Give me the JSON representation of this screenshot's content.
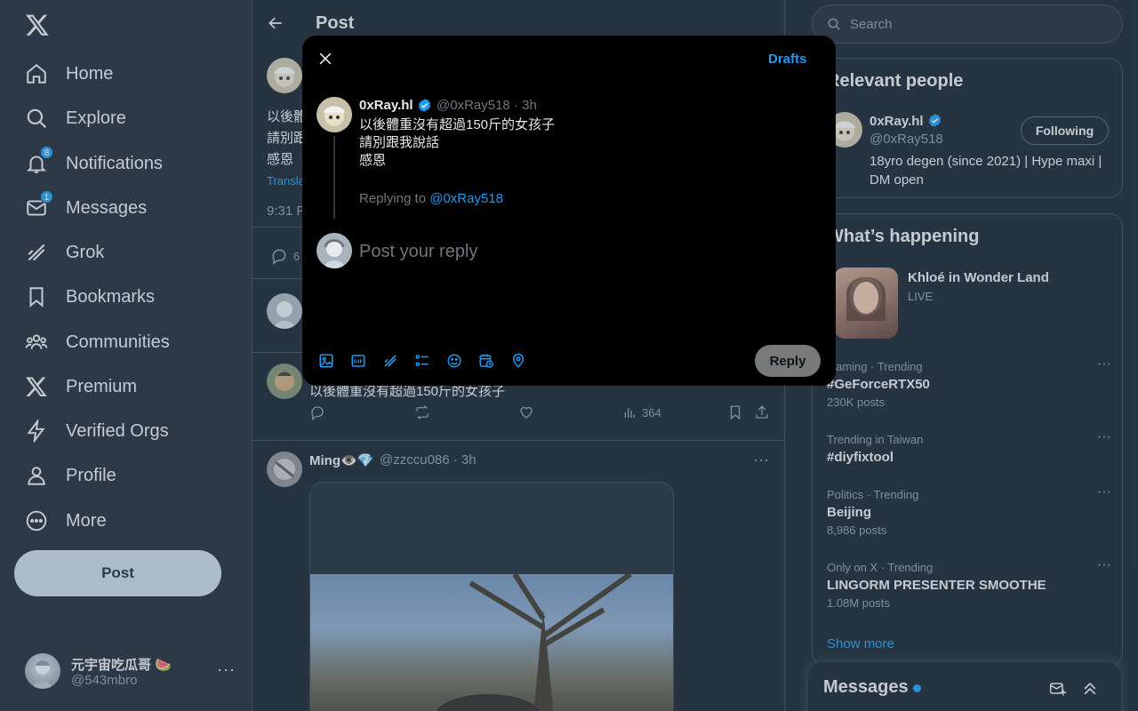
{
  "nav": {
    "items": [
      {
        "label": "Home"
      },
      {
        "label": "Explore"
      },
      {
        "label": "Notifications",
        "badge": "8"
      },
      {
        "label": "Messages",
        "badge": "1"
      },
      {
        "label": "Grok"
      },
      {
        "label": "Bookmarks"
      },
      {
        "label": "Communities"
      },
      {
        "label": "Premium"
      },
      {
        "label": "Verified Orgs"
      },
      {
        "label": "Profile"
      },
      {
        "label": "More"
      }
    ],
    "post_button": "Post",
    "account": {
      "name": "元宇宙吃瓜哥 🍉",
      "handle": "@543mbro",
      "menu": "···"
    }
  },
  "main": {
    "title": "Post",
    "bg_tweet": {
      "line1": "以後體",
      "line2": "請別跟",
      "line3": "感恩",
      "translate": "Transla",
      "time": "9:31 P",
      "reply_count": "6"
    },
    "reply_tweet": {
      "text": "以後體重沒有超過150斤的女孩子",
      "views": "364"
    },
    "tweet2": {
      "name": "Ming👁️💎",
      "meta": "@zzccu086 · 3h",
      "menu": "···"
    }
  },
  "sidebar": {
    "search_placeholder": "Search",
    "relevant": {
      "title": "Relevant people",
      "name": "0xRay.hl",
      "handle": "@0xRay518",
      "bio": "18yro degen (since 2021) | Hype maxi | DM open",
      "follow_label": "Following"
    },
    "happening": {
      "title": "What’s happening",
      "live": {
        "title": "Khloé in Wonder Land",
        "sub": "LIVE"
      },
      "trends": [
        {
          "context": "Gaming · Trending",
          "title": "#GeForceRTX50",
          "count": "230K posts"
        },
        {
          "context": "Trending in Taiwan",
          "title": "#diyfixtool",
          "count": ""
        },
        {
          "context": "Politics · Trending",
          "title": "Beijing",
          "count": "8,986 posts"
        },
        {
          "context": "Only on X · Trending",
          "title": "LINGORM PRESENTER SMOOTHE",
          "count": "1.08M posts"
        }
      ],
      "show_more": "Show more"
    },
    "messages_drawer": "Messages"
  },
  "modal": {
    "drafts": "Drafts",
    "author": {
      "name": "0xRay.hl",
      "meta": "@0xRay518 · 3h"
    },
    "text": "以後體重沒有超過150斤的女孩子\n請別跟我說話\n感恩",
    "replying_prefix": "Replying to ",
    "replying_handle": "@0xRay518",
    "reply_placeholder": "Post your reply",
    "reply_button": "Reply"
  },
  "colors": {
    "accent": "#1d9bf0",
    "bg": "#15202b",
    "modal_bg": "#000000"
  }
}
